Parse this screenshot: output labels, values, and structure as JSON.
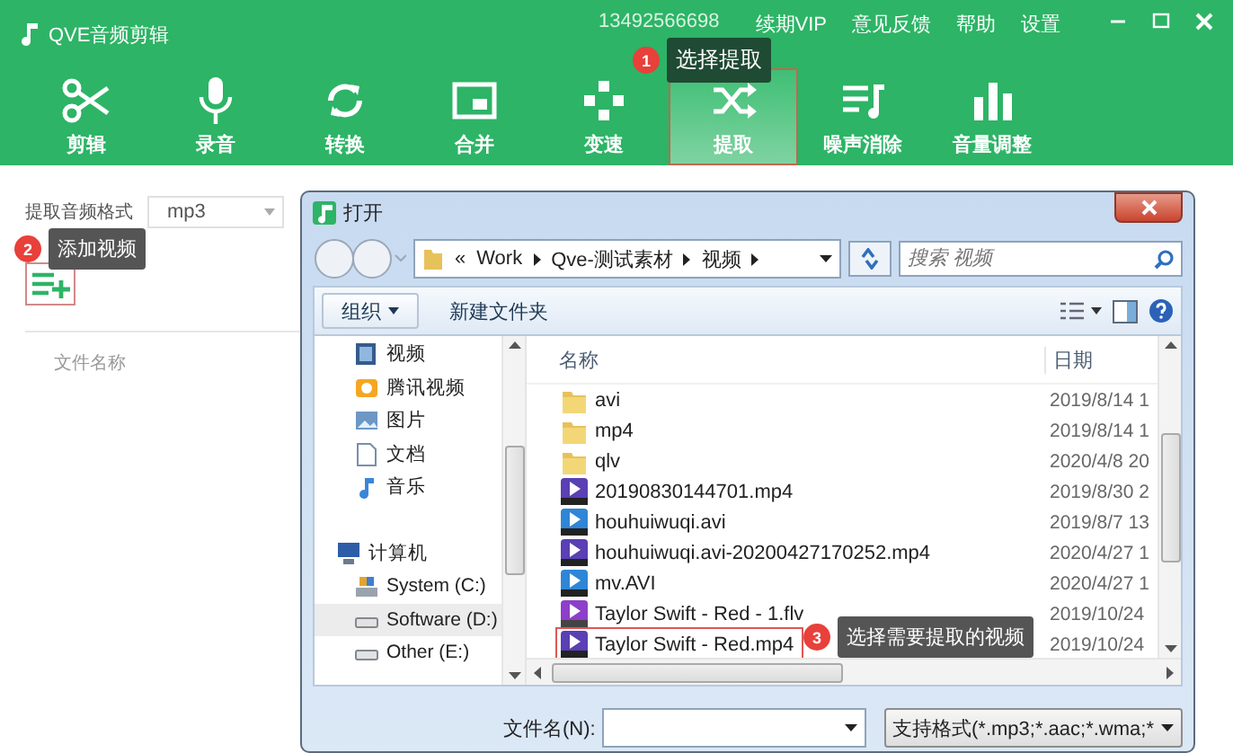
{
  "app": {
    "title": "QVE音频剪辑",
    "account": "13492566698",
    "menu": [
      "续期VIP",
      "意见反馈",
      "帮助",
      "设置"
    ]
  },
  "tools": [
    {
      "label": "剪辑",
      "selected": false
    },
    {
      "label": "录音",
      "selected": false
    },
    {
      "label": "转换",
      "selected": false
    },
    {
      "label": "合并",
      "selected": false
    },
    {
      "label": "变速",
      "selected": false
    },
    {
      "label": "提取",
      "selected": true
    },
    {
      "label": "噪声消除",
      "selected": false
    },
    {
      "label": "音量调整",
      "selected": false
    }
  ],
  "panel": {
    "format_label": "提取音频格式",
    "format_value": "mp3",
    "column_header": "文件名称"
  },
  "callouts": [
    {
      "number": "1",
      "text": "选择提取"
    },
    {
      "number": "2",
      "text": "添加视频"
    },
    {
      "number": "3",
      "text": "选择需要提取的视频"
    }
  ],
  "dialog": {
    "title": "打开",
    "breadcrumb": [
      "«",
      "Work",
      "Qve-测试素材",
      "视频"
    ],
    "search": {
      "placeholder": "搜索 视频"
    },
    "toolbar": [
      "组织",
      "新建文件夹"
    ],
    "nav": [
      {
        "label": "视频",
        "kind": "video",
        "selected": false
      },
      {
        "label": "腾讯视频",
        "kind": "tencent",
        "selected": false
      },
      {
        "label": "图片",
        "kind": "picture",
        "selected": false
      },
      {
        "label": "文档",
        "kind": "document",
        "selected": false
      },
      {
        "label": "音乐",
        "kind": "music",
        "selected": false
      },
      {
        "label": "计算机",
        "kind": "computer",
        "selected": false,
        "children": [
          {
            "label": "System (C:)",
            "kind": "system-drive",
            "selected": false
          },
          {
            "label": "Software (D:)",
            "kind": "drive",
            "selected": true
          },
          {
            "label": "Other (E:)",
            "kind": "drive",
            "selected": false
          }
        ]
      }
    ],
    "columns": [
      "名称",
      "日期"
    ],
    "files": [
      {
        "name": "avi",
        "date": "2019/8/14 1",
        "kind": "folder",
        "highlighted": false
      },
      {
        "name": "mp4",
        "date": "2019/8/14 1",
        "kind": "folder",
        "highlighted": false
      },
      {
        "name": "qlv",
        "date": "2020/4/8 20",
        "kind": "folder",
        "highlighted": false
      },
      {
        "name": "20190830144701.mp4",
        "date": "2019/8/30 2",
        "kind": "mp4",
        "highlighted": false
      },
      {
        "name": "houhuiwuqi.avi",
        "date": "2019/8/7 13",
        "kind": "avi",
        "highlighted": false
      },
      {
        "name": "houhuiwuqi.avi-20200427170252.mp4",
        "date": "2020/4/27 1",
        "kind": "mp4",
        "highlighted": false
      },
      {
        "name": "mv.AVI",
        "date": "2020/4/27 1",
        "kind": "avi",
        "highlighted": false
      },
      {
        "name": "Taylor Swift - Red - 1.flv",
        "date": "2019/10/24",
        "kind": "flv",
        "highlighted": false
      },
      {
        "name": "Taylor Swift - Red.mp4",
        "date": "2019/10/24",
        "kind": "mp4",
        "highlighted": true
      }
    ],
    "filename_label": "文件名(N):",
    "filter": "支持格式(*.mp3;*.aac;*.wma;*"
  }
}
